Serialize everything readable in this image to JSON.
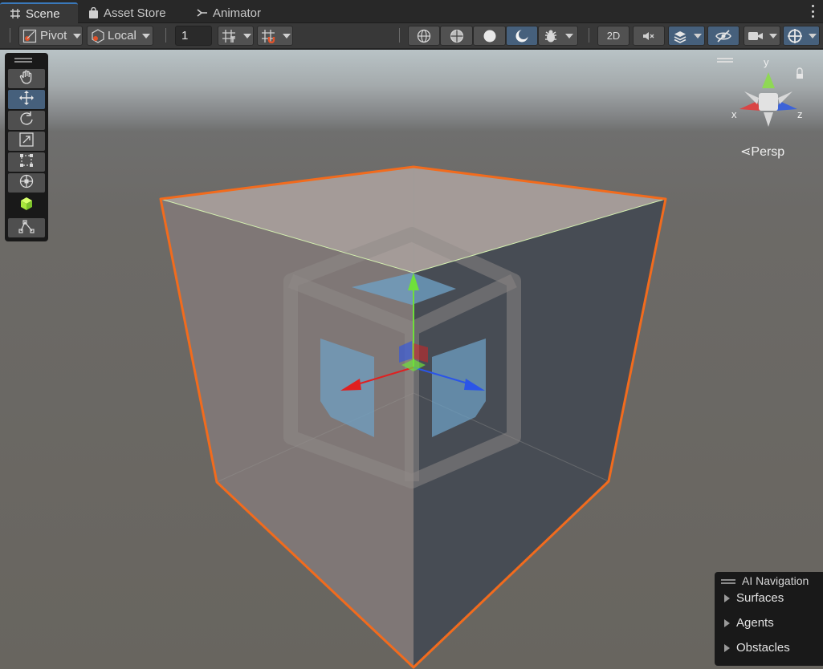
{
  "tabs": [
    {
      "label": "Scene",
      "icon": "grid-icon",
      "active": true
    },
    {
      "label": "Asset Store",
      "icon": "shopping-bag-icon",
      "active": false
    },
    {
      "label": "Animator",
      "icon": "animator-icon",
      "active": false
    }
  ],
  "toolbar": {
    "pivot_label": "Pivot",
    "local_label": "Local",
    "grid_size_value": "1",
    "mode_2d_label": "2D"
  },
  "tools": [
    "hand-tool",
    "move-tool",
    "rotate-tool",
    "scale-tool",
    "rect-tool",
    "transform-tool",
    "custom-editor-tool",
    "spline-tool"
  ],
  "gizmo": {
    "axis_y": "y",
    "axis_x": "x",
    "axis_z": "z",
    "projection_label": "Persp"
  },
  "ai_navigation": {
    "title": "AI Navigation",
    "items": [
      "Surfaces",
      "Agents",
      "Obstacles"
    ]
  },
  "colors": {
    "selection_outline": "#f26b1d",
    "axis_x": "#e02020",
    "axis_y": "#6fe03a",
    "axis_z": "#2b55e8",
    "active_button": "#46607c"
  }
}
